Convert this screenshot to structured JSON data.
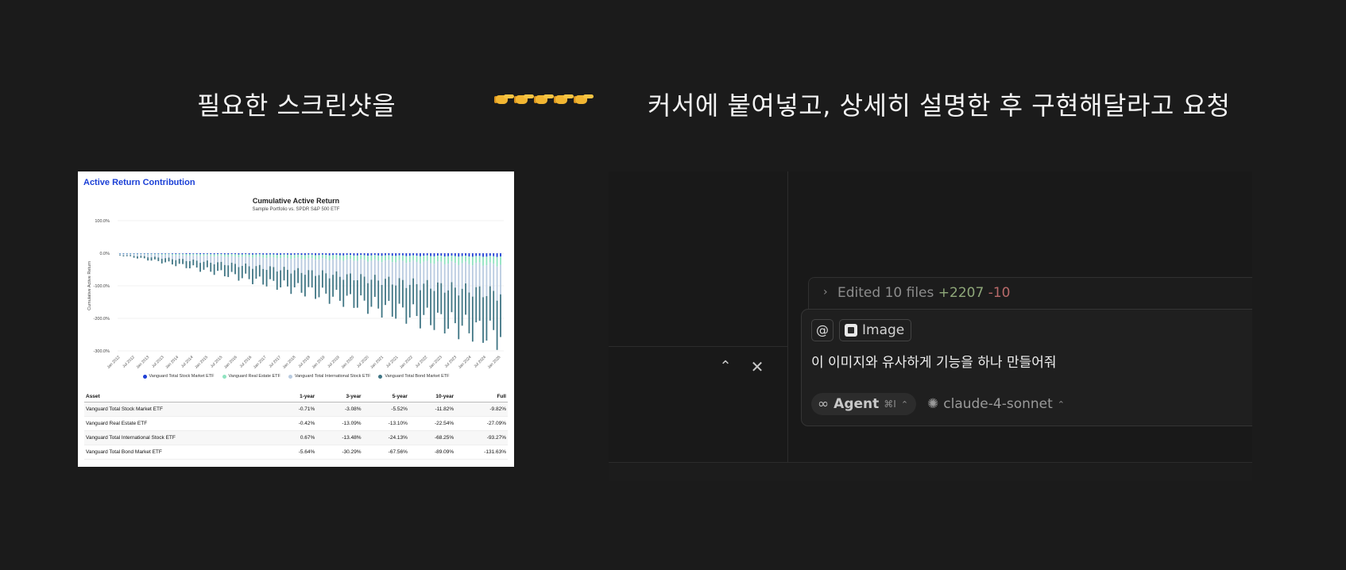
{
  "captions": {
    "left": "필요한 스크린샷을",
    "right": "커서에 붙여넣고, 상세히 설명한 후 구현해달라고 요청"
  },
  "pointer_icons": [
    "pointing-hand-icon",
    "pointing-hand-icon",
    "pointing-hand-icon",
    "pointing-hand-icon",
    "pointing-hand-icon"
  ],
  "report": {
    "card_title": "Active Return Contribution",
    "chart_title": "Cumulative Active Return",
    "chart_subtitle": "Sample Portfolio vs. SPDR S&P 500 ETF",
    "ylabel": "Cumulative Active Return",
    "table_headers": [
      "Asset",
      "1-year",
      "3-year",
      "5-year",
      "10-year",
      "Full"
    ],
    "table_rows": [
      [
        "Vanguard Total Stock Market ETF",
        "-0.71%",
        "-3.08%",
        "-5.52%",
        "-11.82%",
        "-9.82%"
      ],
      [
        "Vanguard Real Estate ETF",
        "-0.42%",
        "-13.09%",
        "-13.10%",
        "-22.54%",
        "-27.09%"
      ],
      [
        "Vanguard Total International Stock ETF",
        "0.67%",
        "-13.48%",
        "-24.13%",
        "-68.25%",
        "-93.27%"
      ],
      [
        "Vanguard Total Bond Market ETF",
        "-5.64%",
        "-30.29%",
        "-67.56%",
        "-89.09%",
        "-131.63%"
      ]
    ]
  },
  "chart_data": {
    "type": "bar",
    "title": "Cumulative Active Return",
    "subtitle": "Sample Portfolio vs. SPDR S&P 500 ETF",
    "ylabel": "Cumulative Active Return",
    "ylim": [
      -300,
      100
    ],
    "yticks": [
      "100.0%",
      "0.0%",
      "-100.0%",
      "-200.0%",
      "-300.0%"
    ],
    "ytick_values": [
      100,
      0,
      -100,
      -200,
      -300
    ],
    "x_tick_labels": [
      "Jan 2012",
      "Jul 2012",
      "Jan 2013",
      "Jul 2013",
      "Jan 2014",
      "Jul 2014",
      "Jan 2015",
      "Jul 2015",
      "Jan 2016",
      "Jul 2016",
      "Jan 2017",
      "Jul 2017",
      "Jan 2018",
      "Jul 2018",
      "Jan 2019",
      "Jul 2019",
      "Jan 2020",
      "Jul 2020",
      "Jan 2021",
      "Jul 2021",
      "Jan 2022",
      "Jul 2022",
      "Jan 2023",
      "Jul 2023",
      "Jan 2024",
      "Jul 2024",
      "Jan 2025"
    ],
    "stacked": true,
    "grid": true,
    "legend_position": "bottom",
    "series": [
      {
        "name": "Vanguard Total Stock Market ETF",
        "color": "#1f3fd6",
        "start": -1,
        "end": -10
      },
      {
        "name": "Vanguard Real Estate ETF",
        "color": "#8fe3c0",
        "start": -1,
        "end": -25
      },
      {
        "name": "Vanguard Total International Stock ETF",
        "color": "#b9cbe0",
        "start": -3,
        "end": -90
      },
      {
        "name": "Vanguard Total Bond Market ETF",
        "color": "#3f7584",
        "start": -2,
        "end": -130
      }
    ]
  },
  "editor": {
    "edited_prefix": "Edited 10 files",
    "edited_add": "+2207",
    "edited_del": "-10",
    "at_symbol": "@",
    "image_chip": "Image",
    "prompt": "이 이미지와 유사하게 기능을 하나 만들어줘",
    "agent_label": "Agent",
    "agent_shortcut": "⌘I",
    "model": "claude-4-sonnet"
  }
}
